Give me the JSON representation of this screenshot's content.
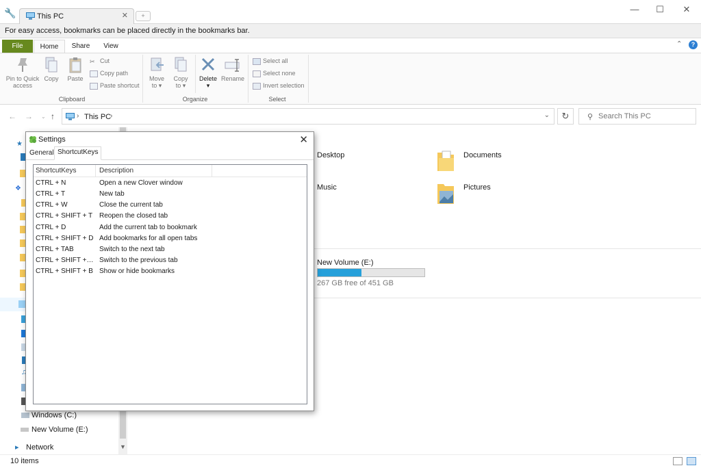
{
  "titlebar": {
    "tab_title": "This PC",
    "tab_close": "✕",
    "new_tab": "+"
  },
  "bookmarks_hint": "For easy access, bookmarks can be placed directly in the bookmarks bar.",
  "ribbon_tabs": {
    "file": "File",
    "home": "Home",
    "share": "Share",
    "view": "View"
  },
  "ribbon": {
    "pin": [
      "Pin to Quick",
      "access"
    ],
    "copy": "Copy",
    "paste": "Paste",
    "cut": "Cut",
    "copy_path": "Copy path",
    "paste_shortcut": "Paste shortcut",
    "clipboard_label": "Clipboard",
    "move_to": [
      "Move",
      "to"
    ],
    "copy_to": [
      "Copy",
      "to"
    ],
    "delete": "Delete",
    "rename": "Rename",
    "organize_label": "Organize",
    "select_all": "Select all",
    "select_none": "Select none",
    "invert_selection": "Invert selection",
    "select_label": "Select"
  },
  "address": {
    "path": "This PC",
    "search_placeholder": "Search This PC"
  },
  "nav": {
    "windows_c": "Windows (C:)",
    "new_volume": "New Volume (E:)",
    "network": "Network"
  },
  "folders": [
    "Desktop",
    "Documents",
    "Music",
    "Pictures"
  ],
  "drive": {
    "name": "New Volume (E:)",
    "free_text": "267 GB free of 451 GB",
    "used_fraction": 0.408
  },
  "status": {
    "items": "10 items"
  },
  "dialog": {
    "title": "Settings",
    "tabs": [
      "General",
      "ShortcutKeys"
    ],
    "columns": [
      "ShortcutKeys",
      "Description"
    ],
    "rows": [
      {
        "key": "CTRL + N",
        "desc": "Open a new Clover window"
      },
      {
        "key": "CTRL + T",
        "desc": "New tab"
      },
      {
        "key": "CTRL + W",
        "desc": "Close the current tab"
      },
      {
        "key": "CTRL + SHIFT + T",
        "desc": "Reopen the closed tab"
      },
      {
        "key": "CTRL + D",
        "desc": "Add the current tab to bookmark"
      },
      {
        "key": "CTRL + SHIFT + D",
        "desc": "Add bookmarks for all open tabs"
      },
      {
        "key": "CTRL + TAB",
        "desc": "Switch to the next tab"
      },
      {
        "key": "CTRL + SHIFT + T...",
        "desc": "Switch to the previous tab"
      },
      {
        "key": "CTRL + SHIFT + B",
        "desc": "Show or hide bookmarks"
      }
    ]
  },
  "colors": {
    "file_tab": "#67891e",
    "accent": "#26a0da",
    "folder": "#f5c85a",
    "help": "#2d7fd3"
  }
}
